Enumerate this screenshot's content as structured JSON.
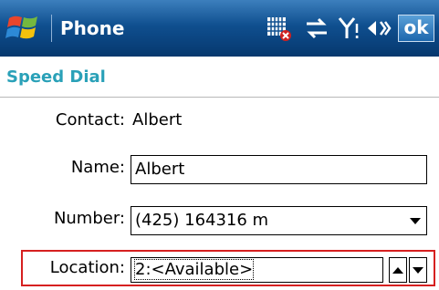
{
  "titlebar": {
    "app_title": "Phone",
    "ok_label": "ok",
    "icons": [
      "windows-start-icon",
      "sim-missing-icon",
      "connectivity-icon",
      "signal-icon",
      "speaker-icon"
    ]
  },
  "page": {
    "title": "Speed Dial"
  },
  "form": {
    "contact": {
      "label": "Contact:",
      "value": "Albert"
    },
    "name": {
      "label": "Name:",
      "value": "Albert"
    },
    "number": {
      "label": "Number:",
      "value": "(425) 164316 m"
    },
    "location": {
      "label": "Location:",
      "value": "2:<Available>"
    }
  },
  "colors": {
    "titlebar": "#0f4f8f",
    "page_title": "#2aa1b8",
    "highlight": "#d62020"
  }
}
